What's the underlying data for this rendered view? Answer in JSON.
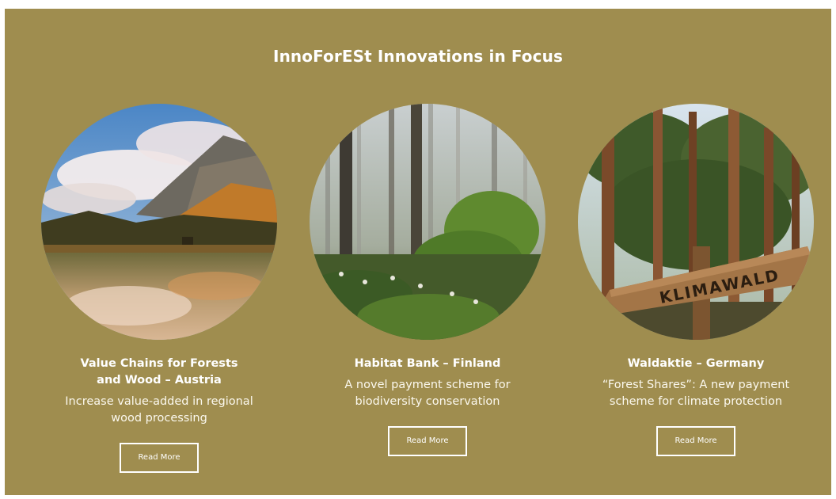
{
  "section": {
    "title": "InnoForESt Innovations in Focus"
  },
  "cards": [
    {
      "title": "Value Chains for Forests and Wood – Austria",
      "description": "Increase value-added in regional wood processing",
      "button_label": "Read More",
      "image": "alpine-lake-landscape"
    },
    {
      "title": "Habitat Bank – Finland",
      "description": "A novel payment scheme for biodiversity conservation",
      "button_label": "Read More",
      "image": "misty-pine-forest"
    },
    {
      "title": "Waldaktie – Germany",
      "description": "“Forest Shares”: A new payment scheme for climate protection",
      "button_label": "Read More",
      "image": "pine-forest-signpost",
      "sign_text": "KLIMAWALD"
    }
  ],
  "colors": {
    "panel_background": "#9f8d4f",
    "text": "#ffffff"
  }
}
